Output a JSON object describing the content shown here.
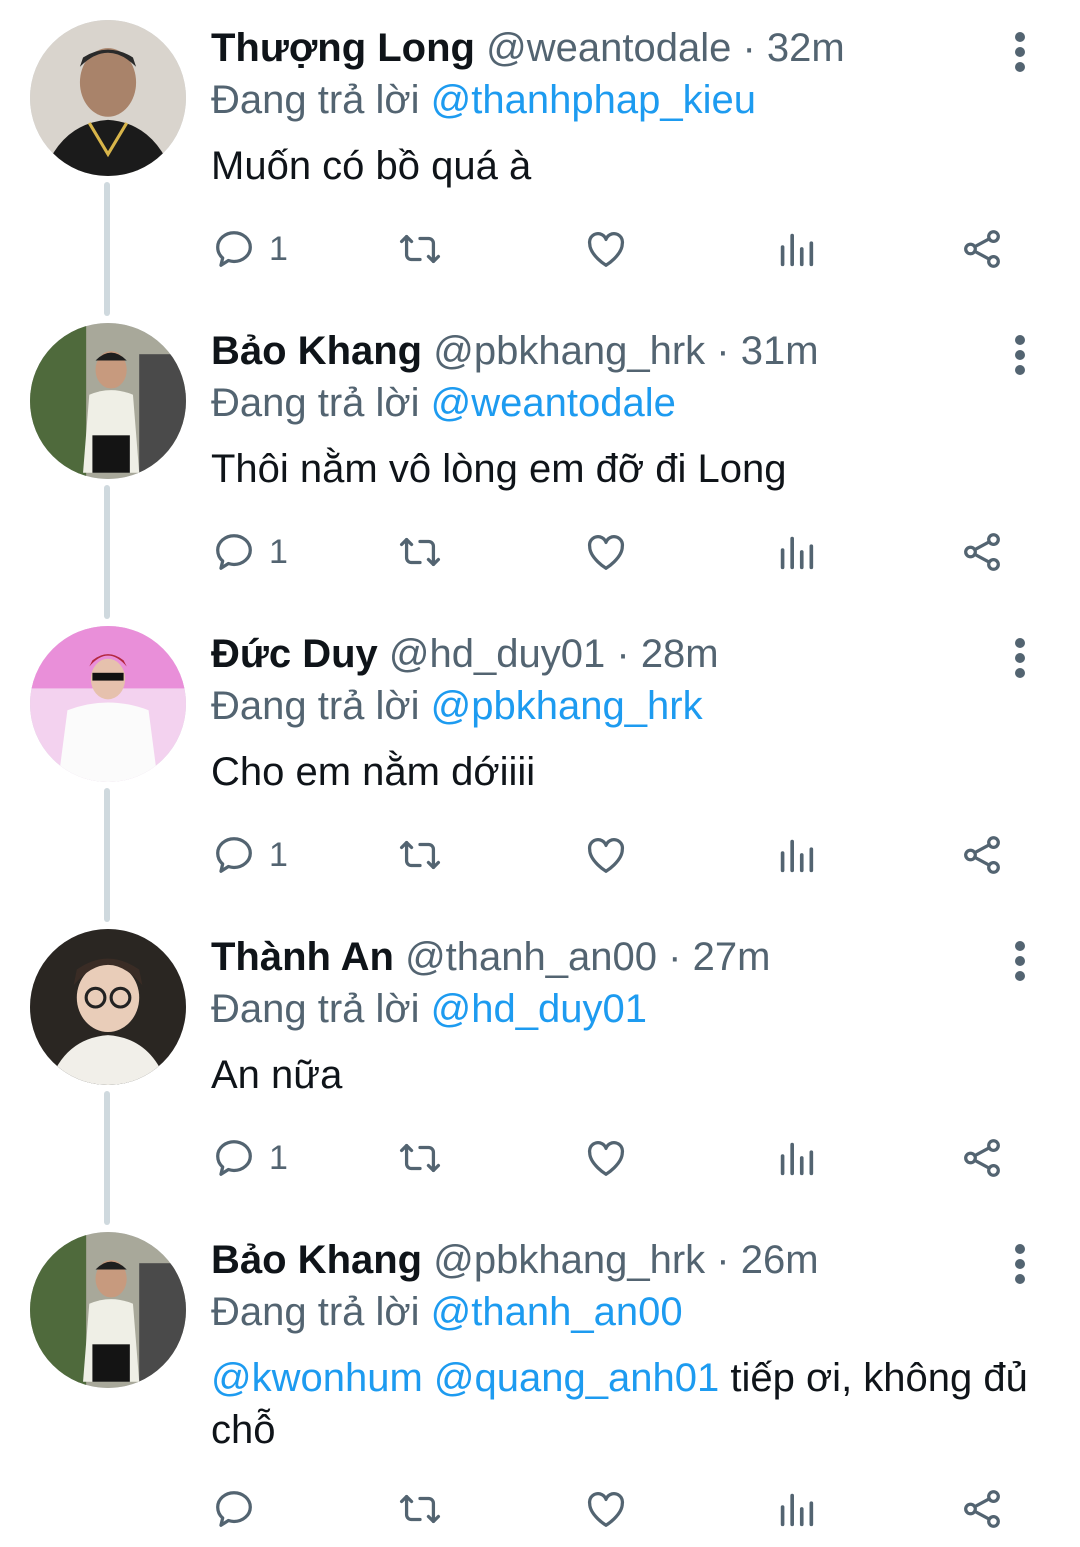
{
  "replying_label": "Đang trả lời",
  "colors": {
    "mention": "#1d9bf0",
    "secondary": "#536471",
    "thread_line": "#cfd9de"
  },
  "tweets": [
    {
      "name": "Thượng Long",
      "handle": "@weantodale",
      "separator": "·",
      "time": "32m",
      "replying_to": "@thanhphap_kieu",
      "mentions": "",
      "text": "Muốn có bồ quá à",
      "reply_count": "1"
    },
    {
      "name": "Bảo Khang",
      "handle": "@pbkhang_hrk",
      "separator": "·",
      "time": "31m",
      "replying_to": "@weantodale",
      "mentions": "",
      "text": "Thôi nằm vô lòng em đỡ đi Long",
      "reply_count": "1"
    },
    {
      "name": "Đức Duy",
      "handle": "@hd_duy01",
      "separator": "·",
      "time": "28m",
      "replying_to": "@pbkhang_hrk",
      "mentions": "",
      "text": "Cho em nằm dớiiii",
      "reply_count": "1"
    },
    {
      "name": "Thành An",
      "handle": "@thanh_an00",
      "separator": "·",
      "time": "27m",
      "replying_to": "@hd_duy01",
      "mentions": "",
      "text": "An nữa",
      "reply_count": "1"
    },
    {
      "name": "Bảo Khang",
      "handle": "@pbkhang_hrk",
      "separator": "·",
      "time": "26m",
      "replying_to": "@thanh_an00",
      "mentions": "@kwonhum @quang_anh01",
      "text": " tiếp ơi, không đủ chỗ",
      "reply_count": ""
    }
  ],
  "icons": {
    "reply": "reply-icon",
    "retweet": "retweet-icon",
    "like": "heart-icon",
    "views": "views-icon",
    "share": "share-icon",
    "more": "more-vertical-icon"
  }
}
